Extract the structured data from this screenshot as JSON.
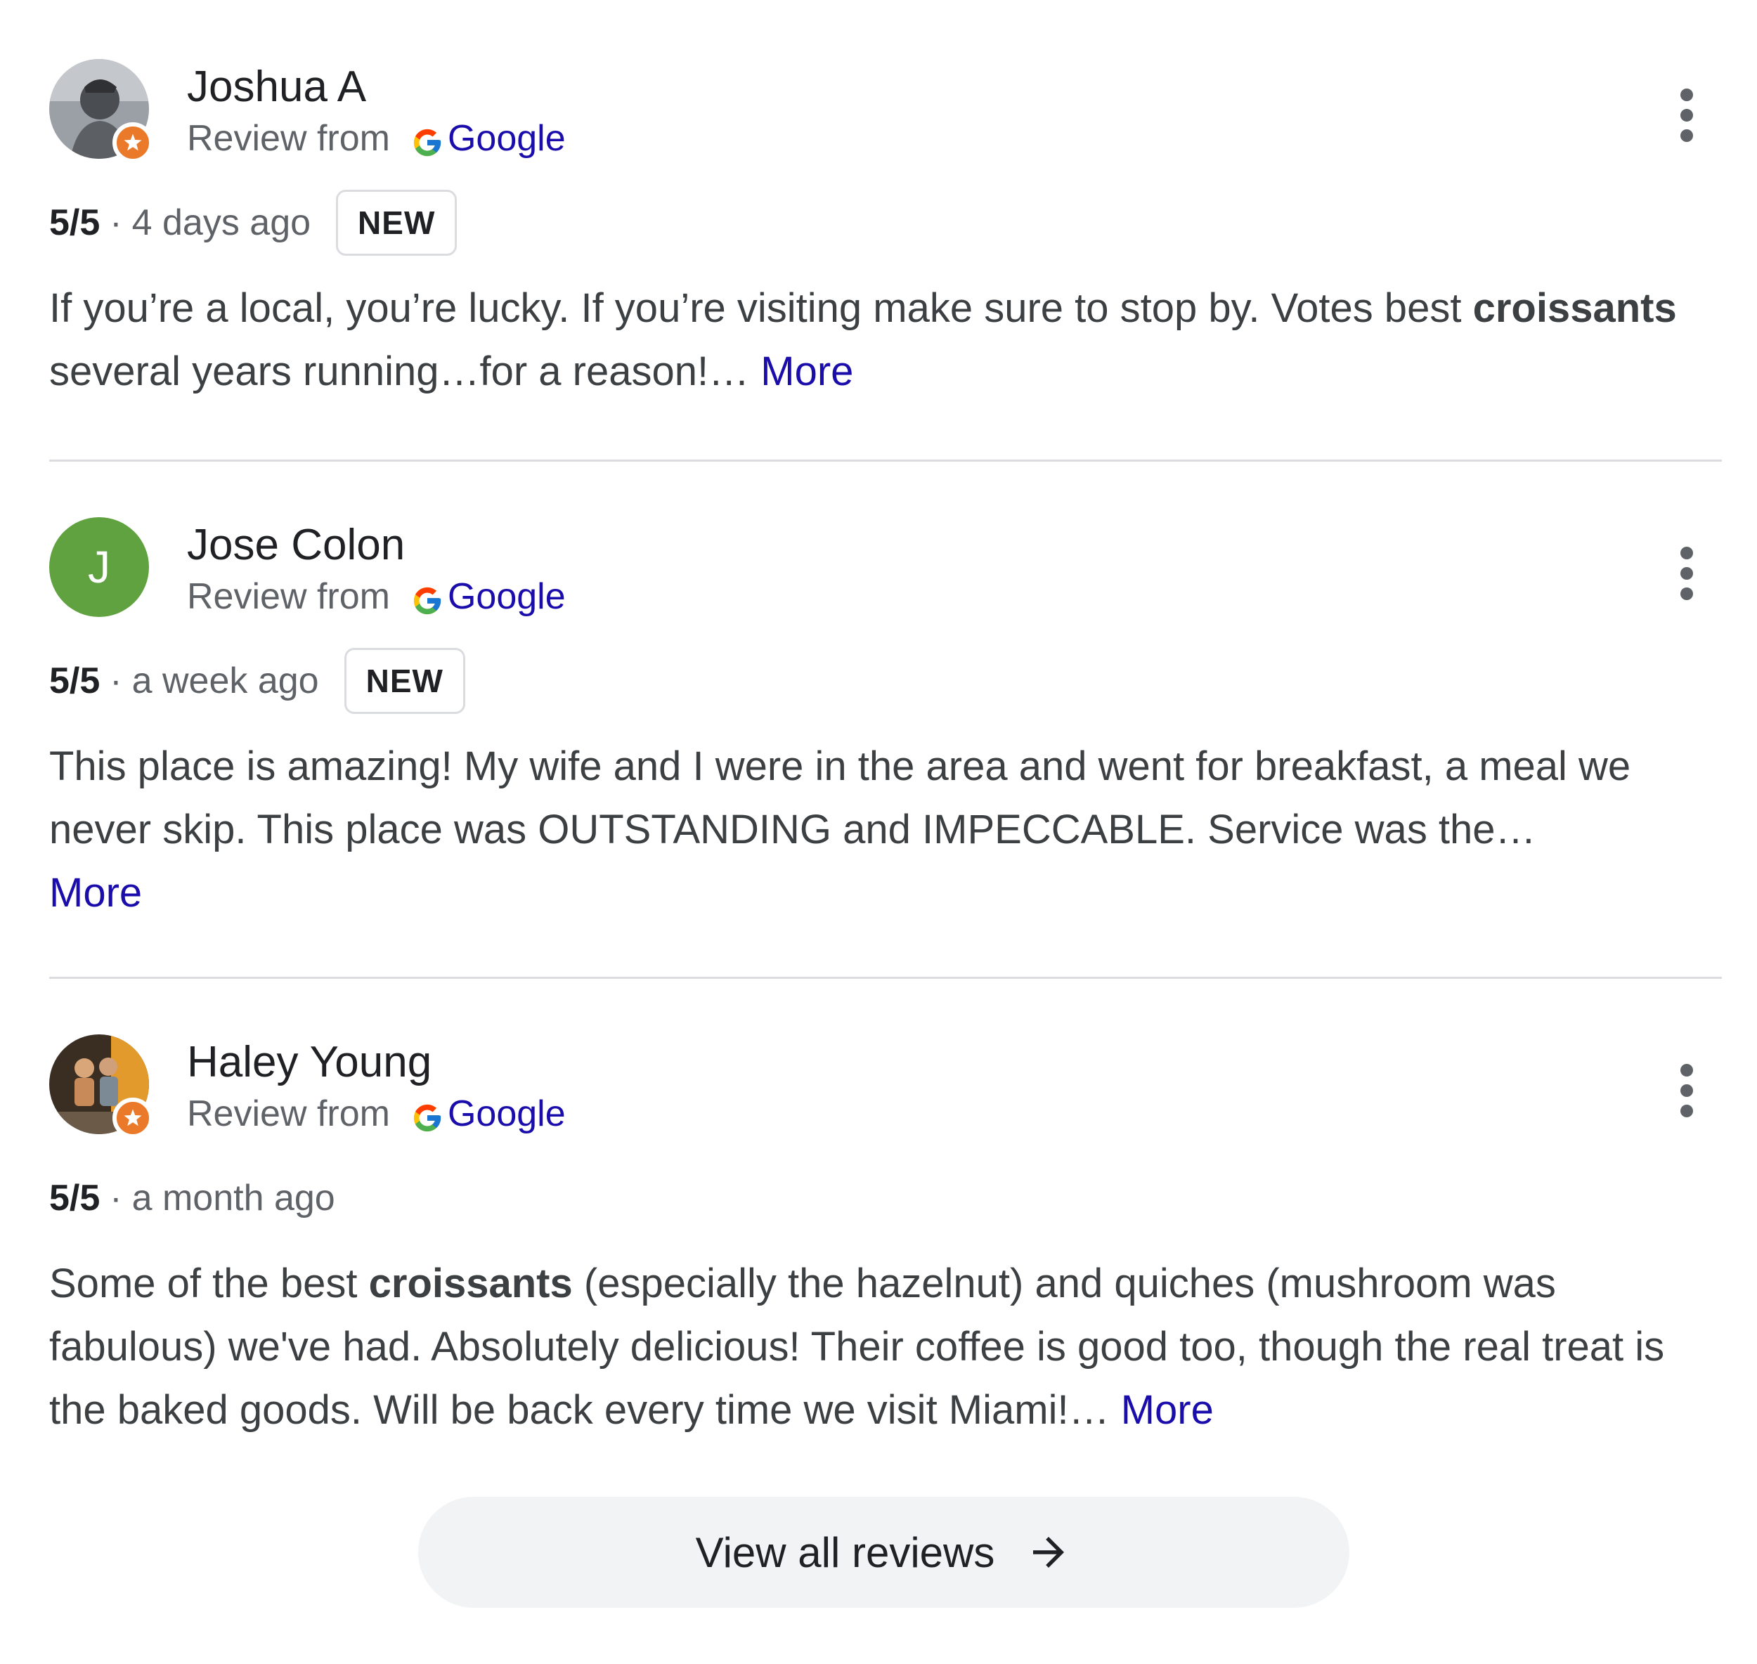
{
  "reviews": [
    {
      "name": "Joshua A",
      "source_prefix": "Review from",
      "source_name": "Google",
      "rating": "5/5",
      "separator": "·",
      "when": "4 days ago",
      "badge": "NEW",
      "text_parts": [
        "If you’re a local, you’re lucky. If you’re visiting make sure to stop by. Votes best ",
        "croissants",
        " several years running…for a reason!… "
      ],
      "more": "More",
      "avatar": {
        "type": "photo",
        "local_guide": true
      }
    },
    {
      "name": "Jose Colon",
      "source_prefix": "Review from",
      "source_name": "Google",
      "rating": "5/5",
      "separator": "·",
      "when": "a week ago",
      "badge": "NEW",
      "text_parts": [
        "This place is amazing! My wife and I were in the area and went for breakfast, a meal we never skip. This place was OUTSTANDING and IMPECCABLE. Service was the…"
      ],
      "more": "More",
      "avatar": {
        "type": "letter",
        "letter": "J",
        "color": "#5fa23f",
        "local_guide": false
      }
    },
    {
      "name": "Haley Young",
      "source_prefix": "Review from",
      "source_name": "Google",
      "rating": "5/5",
      "separator": "·",
      "when": "a month ago",
      "badge": "",
      "text_parts": [
        "Some of the best ",
        "croissants",
        " (especially the hazelnut) and quiches (mushroom was fabulous) we've had. Absolutely delicious! Their coffee is good too, though the real treat is the baked goods. Will be back every time we visit Miami!… "
      ],
      "more": "More",
      "avatar": {
        "type": "photo",
        "local_guide": true
      }
    }
  ],
  "view_all": {
    "label": "View all reviews",
    "icon": "arrow-right-icon"
  },
  "colors": {
    "link": "#1a0dab",
    "divider": "#dadce0",
    "local_guide_badge": "#ea7a2a",
    "button_bg": "#f1f3f4"
  }
}
